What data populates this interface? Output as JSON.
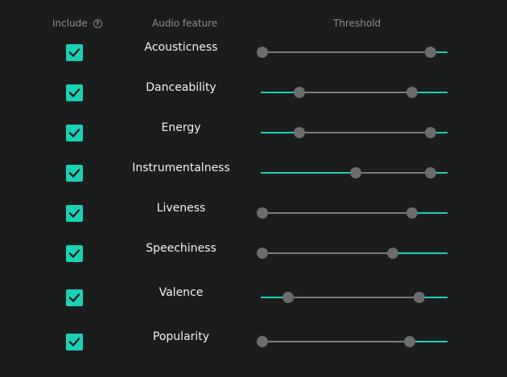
{
  "header": {
    "include_label": "Include",
    "help_icon": "help-circle-icon",
    "feature_label": "Audio feature",
    "threshold_label": "Threshold"
  },
  "colors": {
    "accent": "#19d1b7",
    "background": "#1b1c1c",
    "thumb": "#6c6c6c",
    "rail_inactive": "#7a7a7a"
  },
  "features": [
    {
      "name": "Acousticness",
      "included": true,
      "range": [
        0.0,
        0.9
      ]
    },
    {
      "name": "Danceability",
      "included": true,
      "range": [
        0.2,
        0.8
      ]
    },
    {
      "name": "Energy",
      "included": true,
      "range": [
        0.2,
        0.9
      ]
    },
    {
      "name": "Instrumentalness",
      "included": true,
      "range": [
        0.5,
        0.9
      ]
    },
    {
      "name": "Liveness",
      "included": true,
      "range": [
        0.0,
        0.8
      ]
    },
    {
      "name": "Speechiness",
      "included": true,
      "range": [
        0.0,
        0.7
      ]
    },
    {
      "name": "Valence",
      "included": true,
      "range": [
        0.14,
        0.84
      ]
    },
    {
      "name": "Popularity",
      "included": true,
      "range": [
        0.0,
        0.79
      ]
    }
  ]
}
